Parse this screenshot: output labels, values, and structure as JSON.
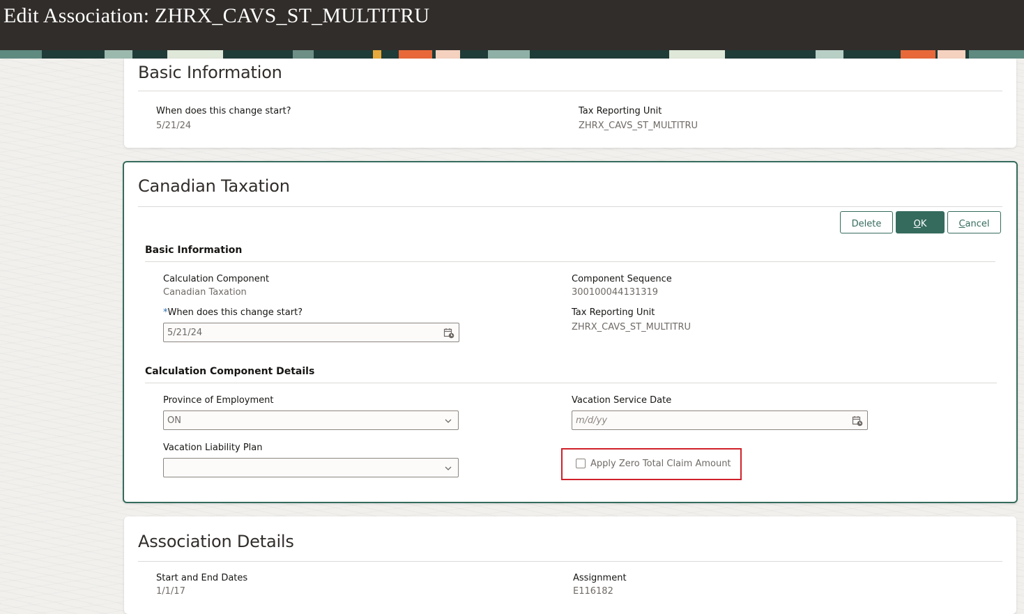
{
  "header": {
    "title": "Edit Association: ZHRX_CAVS_ST_MULTITRU"
  },
  "basic_info_card": {
    "title": "Basic Information",
    "change_start_label": "When does this change start?",
    "change_start_value": "5/21/24",
    "tru_label": "Tax Reporting Unit",
    "tru_value": "ZHRX_CAVS_ST_MULTITRU"
  },
  "taxation_card": {
    "title": "Canadian Taxation",
    "buttons": {
      "delete": "Delete",
      "ok_first": "O",
      "ok_rest": "K",
      "cancel_first": "C",
      "cancel_rest": "ancel"
    },
    "basic_section": {
      "heading": "Basic Information",
      "calc_component_label": "Calculation Component",
      "calc_component_value": "Canadian Taxation",
      "required_marker": "*",
      "change_start_label": "When does this change start?",
      "change_start_value": "5/21/24",
      "component_sequence_label": "Component Sequence",
      "component_sequence_value": "300100044131319",
      "tru_label": "Tax Reporting Unit",
      "tru_value": "ZHRX_CAVS_ST_MULTITRU"
    },
    "details_section": {
      "heading": "Calculation Component Details",
      "province_label": "Province of Employment",
      "province_value": "ON",
      "vacation_service_date_label": "Vacation Service Date",
      "vacation_service_date_placeholder": "m/d/yy",
      "vacation_liability_plan_label": "Vacation Liability Plan",
      "vacation_liability_plan_value": "",
      "apply_zero_label": "Apply Zero Total Claim Amount",
      "apply_zero_checked": false
    }
  },
  "association_card": {
    "title": "Association Details",
    "dates_label": "Start and End Dates",
    "dates_value": "1/1/17",
    "assignment_label": "Assignment",
    "assignment_value": "E116182"
  },
  "colors": {
    "header_bg": "#312d2a",
    "accent_green": "#356b5d",
    "highlight_red": "#d0202a"
  },
  "icons": {
    "date_picker": "calendar-clock-icon",
    "dropdown": "chevron-down-icon"
  }
}
